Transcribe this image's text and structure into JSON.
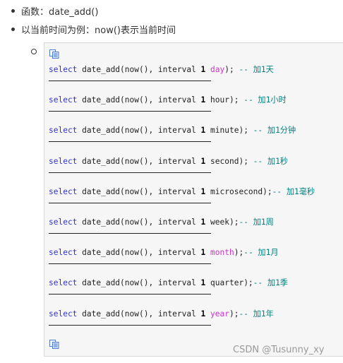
{
  "bullets": [
    {
      "text": "函数：date_add()"
    },
    {
      "text": "以当前时间为例：now()表示当前时间"
    }
  ],
  "code_lines": [
    {
      "kw": "select",
      "pre": " date_add(now(), interval ",
      "num": "1",
      "unit": " day",
      "unit_highlight": true,
      "post": "); ",
      "comment": "-- 加1天"
    },
    {
      "kw": "select",
      "pre": " date_add(now(), interval ",
      "num": "1",
      "unit": " hour",
      "unit_highlight": false,
      "post": "); ",
      "comment": "-- 加1小时"
    },
    {
      "kw": "select",
      "pre": " date_add(now(), interval ",
      "num": "1",
      "unit": " minute",
      "unit_highlight": false,
      "post": "); ",
      "comment": "-- 加1分钟"
    },
    {
      "kw": "select",
      "pre": " date_add(now(), interval ",
      "num": "1",
      "unit": " second",
      "unit_highlight": false,
      "post": "); ",
      "comment": "-- 加1秒"
    },
    {
      "kw": "select",
      "pre": " date_add(now(), interval ",
      "num": "1",
      "unit": " microsecond",
      "unit_highlight": false,
      "post": ");",
      "comment": "-- 加1毫秒"
    },
    {
      "kw": "select",
      "pre": " date_add(now(), interval ",
      "num": "1",
      "unit": " week",
      "unit_highlight": false,
      "post": ");",
      "comment": "-- 加1周"
    },
    {
      "kw": "select",
      "pre": " date_add(now(), interval ",
      "num": "1",
      "unit": " month",
      "unit_highlight": true,
      "post": ");",
      "comment": "-- 加1月"
    },
    {
      "kw": "select",
      "pre": " date_add(now(), interval ",
      "num": "1",
      "unit": " quarter",
      "unit_highlight": false,
      "post": ");",
      "comment": "-- 加1季"
    },
    {
      "kw": "select",
      "pre": " date_add(now(), interval ",
      "num": "1",
      "unit": " year",
      "unit_highlight": true,
      "post": ");",
      "comment": "-- 加1年"
    }
  ],
  "icons": {
    "copy_top": "copy-icon",
    "copy_bottom": "copy-icon"
  },
  "colors": {
    "keyword": "#3333cc",
    "highlight": "#cc33cc",
    "comment": "#008080",
    "box_bg": "#f6f6f6"
  },
  "watermark": "CSDN @Tusunny_xy"
}
